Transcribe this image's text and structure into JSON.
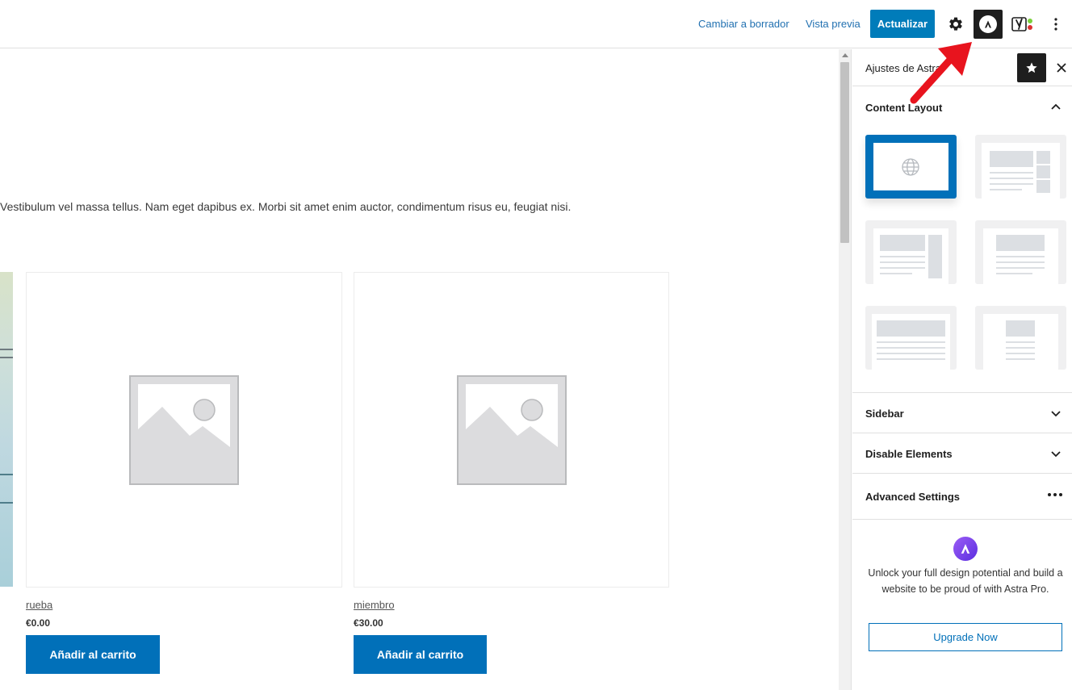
{
  "topbar": {
    "switch_draft": "Cambiar a borrador",
    "preview": "Vista previa",
    "update": "Actualizar"
  },
  "editor": {
    "paragraph": "Vestibulum vel massa tellus. Nam eget dapibus ex. Morbi sit amet enim auctor, condimentum risus eu, feugiat nisi.",
    "products": [
      {
        "name": "rueba",
        "price": "€0.00",
        "button": "Añadir al carrito"
      },
      {
        "name": "miembro",
        "price": "€30.00",
        "button": "Añadir al carrito"
      }
    ]
  },
  "sidebar": {
    "title": "Ajustes de Astra",
    "panels": {
      "content_layout": "Content Layout",
      "sidebar": "Sidebar",
      "disable_elements": "Disable Elements",
      "advanced": "Advanced Settings"
    },
    "promo": {
      "text": "Unlock your full design potential and build a website to be proud of with Astra Pro.",
      "button": "Upgrade Now"
    }
  },
  "colors": {
    "primary": "#007cba",
    "astra_blue": "#0170b9",
    "link": "#2271b1",
    "annotation_arrow": "#e8141e"
  },
  "icons": [
    "settings-gear-icon",
    "astra-icon",
    "yoast-icon",
    "more-vertical-icon",
    "pin-star-icon",
    "close-icon",
    "chevron-up-icon",
    "chevron-down-icon",
    "more-horizontal-icon",
    "globe-icon",
    "image-placeholder-icon"
  ]
}
